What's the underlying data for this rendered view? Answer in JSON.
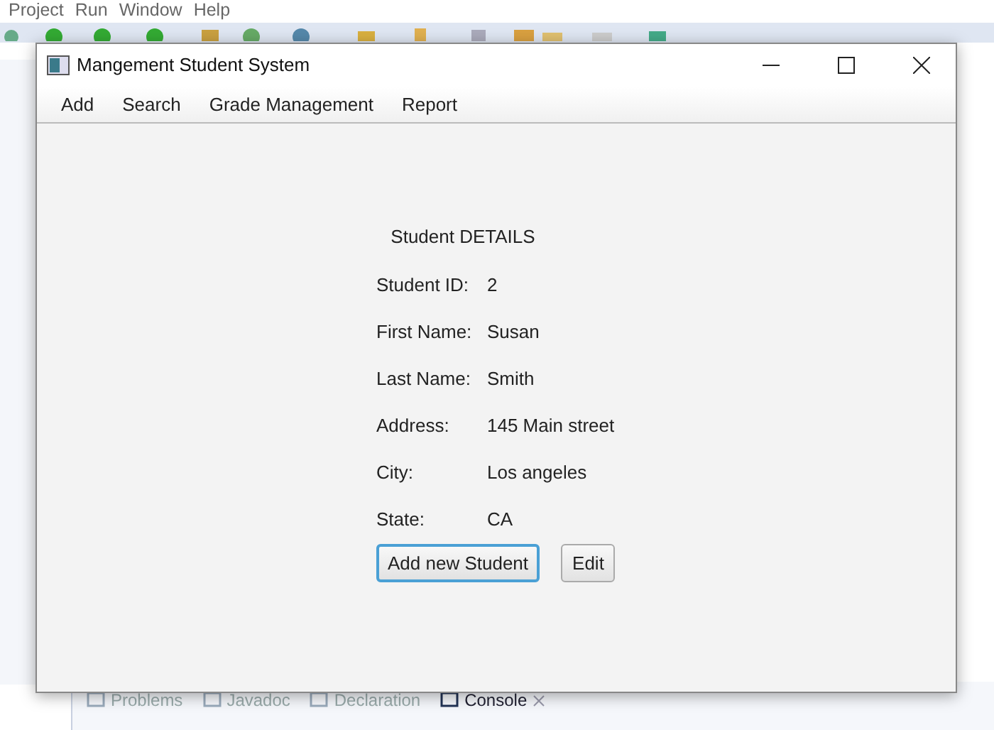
{
  "ide": {
    "menu": [
      "Project",
      "Run",
      "Window",
      "Help"
    ],
    "tabs": [
      {
        "label": "Problems",
        "selected": false
      },
      {
        "label": "Javadoc",
        "selected": false
      },
      {
        "label": "Declaration",
        "selected": false
      },
      {
        "label": "Console",
        "selected": true
      }
    ]
  },
  "window": {
    "title": "Mangement Student System",
    "menu": [
      "Add",
      "Search",
      "Grade Management",
      "Report"
    ],
    "heading": "Student DETAILS",
    "fields": [
      {
        "label": "Student ID:",
        "value": "2"
      },
      {
        "label": "First Name:",
        "value": "Susan"
      },
      {
        "label": "Last Name:",
        "value": "Smith"
      },
      {
        "label": "Address:",
        "value": "145 Main street"
      },
      {
        "label": "City:",
        "value": "Los angeles"
      },
      {
        "label": "State:",
        "value": "CA"
      }
    ],
    "buttons": [
      {
        "label": "Add new Student",
        "focused": true
      },
      {
        "label": "Edit",
        "focused": false
      }
    ]
  }
}
